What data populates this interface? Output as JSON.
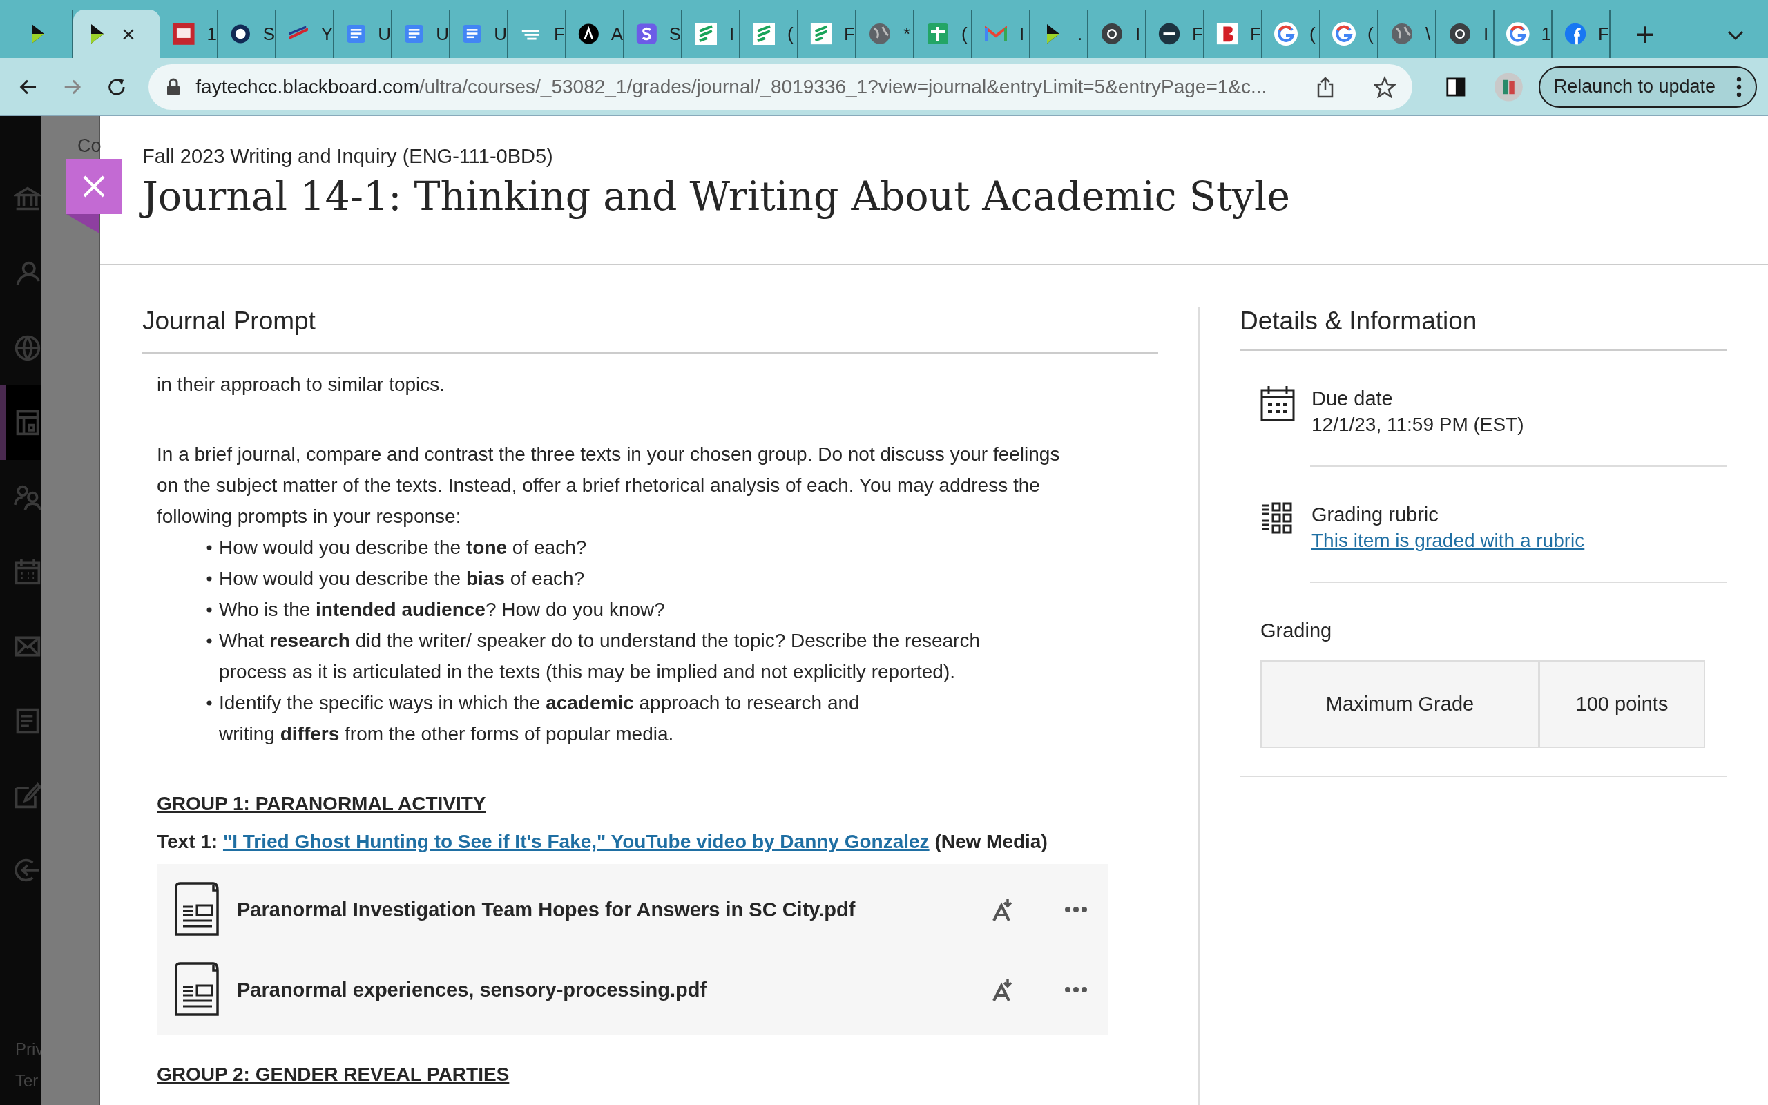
{
  "browser": {
    "tabs": [
      {
        "kind": "play",
        "selected": false
      },
      {
        "kind": "play",
        "selected": true,
        "close": "×"
      },
      {
        "kind": "pb",
        "title": "1",
        "selected": false
      },
      {
        "kind": "ring",
        "title": "S",
        "selected": false
      },
      {
        "kind": "flag",
        "title": "Y",
        "selected": false
      },
      {
        "kind": "doc",
        "title": "U",
        "selected": false
      },
      {
        "kind": "doc",
        "title": "U",
        "selected": false
      },
      {
        "kind": "doc",
        "title": "U",
        "selected": false
      },
      {
        "kind": "lines",
        "title": "F",
        "selected": false
      },
      {
        "kind": "a",
        "title": "A",
        "selected": false
      },
      {
        "kind": "s",
        "title": "S",
        "selected": false
      },
      {
        "kind": "green",
        "title": "I",
        "selected": false
      },
      {
        "kind": "green",
        "title": "(",
        "selected": false
      },
      {
        "kind": "green",
        "title": "F",
        "selected": false
      },
      {
        "kind": "globe",
        "title": "*",
        "selected": false
      },
      {
        "kind": "plus",
        "title": "(",
        "selected": false
      },
      {
        "kind": "mail",
        "title": "I",
        "selected": false
      },
      {
        "kind": "play",
        "title": ".",
        "selected": false
      },
      {
        "kind": "chrome",
        "title": "I",
        "selected": false
      },
      {
        "kind": "fsa",
        "title": "F",
        "selected": false
      },
      {
        "kind": "b",
        "title": "F",
        "selected": false
      },
      {
        "kind": "google",
        "title": "(",
        "selected": false
      },
      {
        "kind": "google",
        "title": "(",
        "selected": false
      },
      {
        "kind": "globe",
        "title": "\\",
        "selected": false
      },
      {
        "kind": "chrome",
        "title": "I",
        "selected": false
      },
      {
        "kind": "google",
        "title": "1",
        "selected": false
      },
      {
        "kind": "facebook",
        "title": "F",
        "selected": false
      }
    ],
    "new_tab": "+",
    "url": {
      "domain": "faytechcc.blackboard.com",
      "path": "/ultra/courses/_53082_1/grades/journal/_8019336_1?view=journal&entryLimit=5&entryPage=1&c..."
    },
    "relaunch_button": "Relaunch to update"
  },
  "sidebar": {
    "items": [
      {
        "kind": "institution",
        "selected": false
      },
      {
        "kind": "person",
        "selected": false
      },
      {
        "kind": "globe",
        "selected": false
      },
      {
        "kind": "grades",
        "selected": true
      },
      {
        "kind": "people",
        "selected": false
      },
      {
        "kind": "calendar",
        "selected": false
      },
      {
        "kind": "mail",
        "selected": false
      },
      {
        "kind": "document",
        "selected": false
      },
      {
        "kind": "edit",
        "selected": false
      },
      {
        "kind": "logout",
        "selected": false
      }
    ],
    "footer": [
      "Priv",
      "Ter"
    ]
  },
  "background_page": {
    "heading": "Co"
  },
  "panel": {
    "course": "Fall 2023 Writing and Inquiry (ENG-111-0BD5)",
    "title": "Journal 14-1: Thinking and Writing About Academic Style",
    "prompt": {
      "heading": "Journal Prompt",
      "paragraphs": [
        "in their approach to similar topics.",
        "In a brief journal, compare and contrast the three texts in your chosen group. Do not discuss your feelings on the subject matter of the texts. Instead, offer a brief rhetorical analysis of each. You may address the following prompts in your response:"
      ],
      "bullets": [
        "How would you describe the **tone** of each?",
        "How would you describe the **bias** of each?",
        "Who is the **intended audience**? How do you know?",
        "What **research** did the writer/ speaker do to understand the topic? Describe the research process as it is articulated in the texts (this may be implied and not explicitly reported).",
        "Identify the specific ways in which the **academic** approach to research and\nwriting **differs** from the other forms of popular media."
      ],
      "groups": [
        {
          "heading": "GROUP 1: PARANORMAL ACTIVITY",
          "text": {
            "label": "Text 1:",
            "link": "\"I Tried Ghost Hunting to See if It's Fake,\" YouTube video by Danny Gonzalez",
            "note": "(New Media)"
          },
          "files": [
            "Paranormal Investigation Team Hopes for Answers in SC City.pdf",
            "Paranormal experiences, sensory-processing.pdf"
          ]
        },
        {
          "heading": "GROUP 2: GENDER REVEAL PARTIES"
        }
      ]
    },
    "details": {
      "heading": "Details & Information",
      "due": {
        "label": "Due date",
        "value": "12/1/23, 11:59 PM (EST)"
      },
      "rubric": {
        "label": "Grading rubric",
        "link": "This item is graded with a rubric"
      },
      "grading": {
        "label": "Grading",
        "cells": [
          "Maximum Grade",
          "100 points"
        ]
      }
    }
  }
}
